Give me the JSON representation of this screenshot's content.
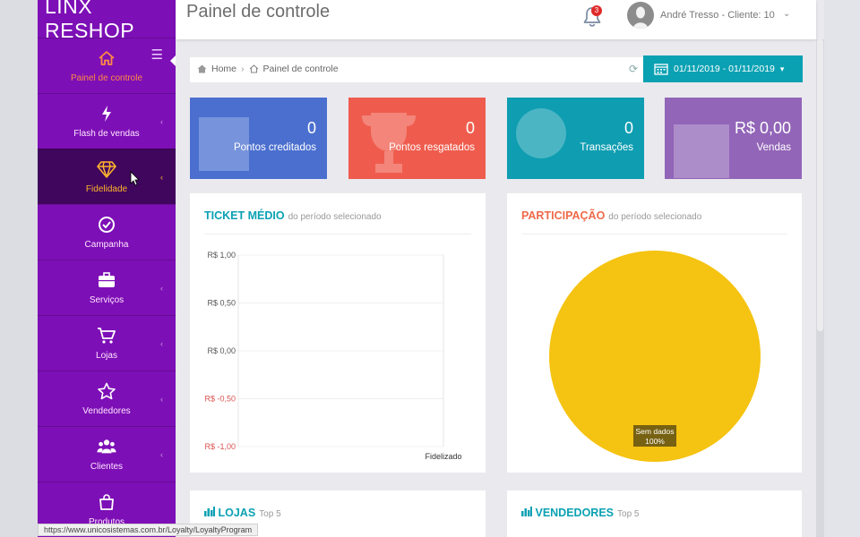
{
  "brand": "LINX RESHOP",
  "sidebar": {
    "items": [
      {
        "label": "Painel de controle",
        "icon": "home-icon"
      },
      {
        "label": "Flash de vendas",
        "icon": "bolt-icon"
      },
      {
        "label": "Fidelidade",
        "icon": "diamond-icon"
      },
      {
        "label": "Campanha",
        "icon": "check-circle-icon"
      },
      {
        "label": "Serviços",
        "icon": "briefcase-icon"
      },
      {
        "label": "Lojas",
        "icon": "cart-icon"
      },
      {
        "label": "Vendedores",
        "icon": "star-icon"
      },
      {
        "label": "Clientes",
        "icon": "users-icon"
      },
      {
        "label": "Produtos",
        "icon": "bag-icon"
      }
    ]
  },
  "header": {
    "title": "Painel de controle",
    "notifications": "3",
    "user": "André Tresso - Cliente: 10"
  },
  "breadcrumb": {
    "home": "Home",
    "current": "Painel de controle",
    "date_range": "01/11/2019 - 01/11/2019"
  },
  "stats": [
    {
      "value": "0",
      "label": "Pontos creditados",
      "color": "#4a6fcf"
    },
    {
      "value": "0",
      "label": "Pontos resgatados",
      "color": "#ef5c4d"
    },
    {
      "value": "0",
      "label": "Transações",
      "color": "#0e9db1"
    },
    {
      "value": "R$ 0,00",
      "label": "Vendas",
      "color": "#9265b8"
    }
  ],
  "ticket": {
    "title": "TICKET MÉDIO",
    "subtitle": "do período selecionado",
    "title_color": "#0aa1b3"
  },
  "participacao": {
    "title": "PARTICIPAÇÃO",
    "subtitle": "do período selecionado",
    "title_color": "#ef6a4a"
  },
  "lojas": {
    "title": "LOJAS",
    "subtitle": "Top 5"
  },
  "vendedores": {
    "title": "VENDEDORES",
    "subtitle": "Top 5"
  },
  "status_url": "https://www.unicosistemas.com.br/Loyalty/LoyaltyProgram",
  "chart_data": [
    {
      "type": "bar",
      "categories": [
        "Fidelizado"
      ],
      "values": [],
      "yticks": [
        "R$ 1,00",
        "R$ 0,50",
        "R$ 0,00",
        "R$ -0,50",
        "R$ -1,00"
      ],
      "ylim": [
        -1,
        1
      ]
    },
    {
      "type": "pie",
      "labels": [
        "Sem dados"
      ],
      "values": [
        100
      ],
      "data_label": "100%",
      "colors": [
        "#f5c311"
      ]
    }
  ]
}
